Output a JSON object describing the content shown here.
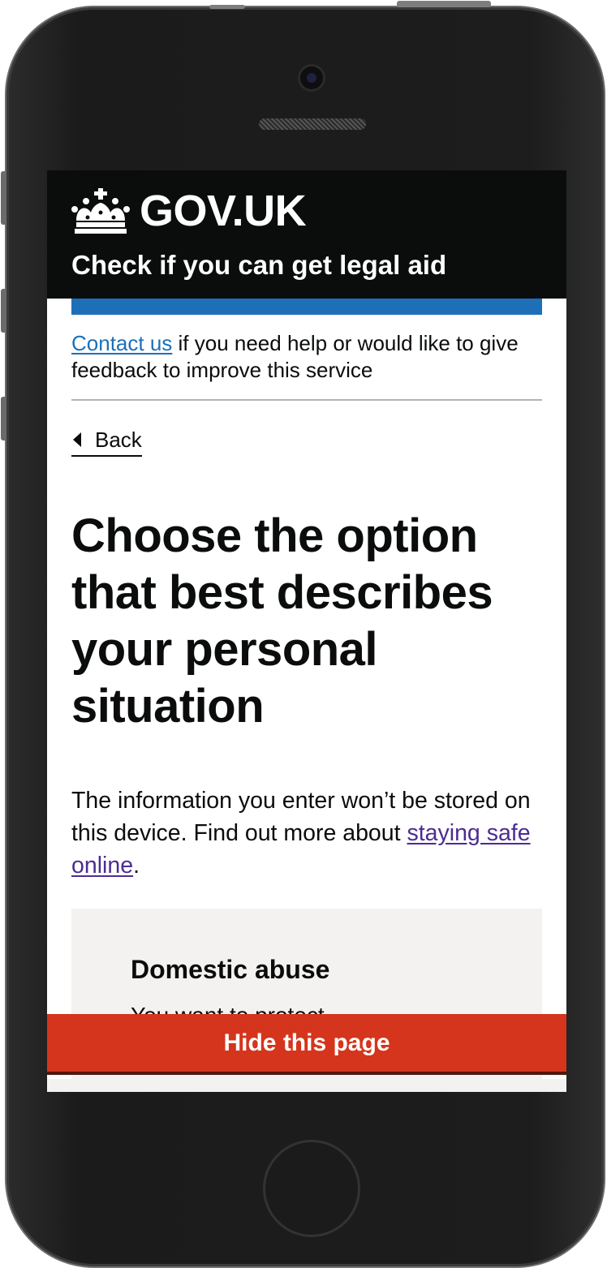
{
  "header": {
    "logo_text": "GOV.UK",
    "service_name": "Check if you can get legal aid"
  },
  "contact": {
    "link_text": "Contact us",
    "rest_text": " if you need help or would like to give feedback to improve this service"
  },
  "back_link": {
    "label": "Back"
  },
  "main": {
    "heading": "Choose the option that best describes your personal situation",
    "intro_text": "The information you enter won’t be stored on this device. Find out more about ",
    "intro_link": "staying safe online",
    "intro_end": "."
  },
  "option": {
    "title": "Domestic abuse",
    "description": "You want to protect"
  },
  "hide_button": {
    "label": "Hide this page"
  },
  "colors": {
    "header_bg": "#0b0c0c",
    "service_bar": "#1d70b8",
    "link": "#1d70b8",
    "visited_link": "#4c2c92",
    "hide_button": "#d4351c",
    "panel_bg": "#f3f2f1"
  },
  "icons": {
    "logo": "crown-icon",
    "back": "triangle-left-icon"
  }
}
